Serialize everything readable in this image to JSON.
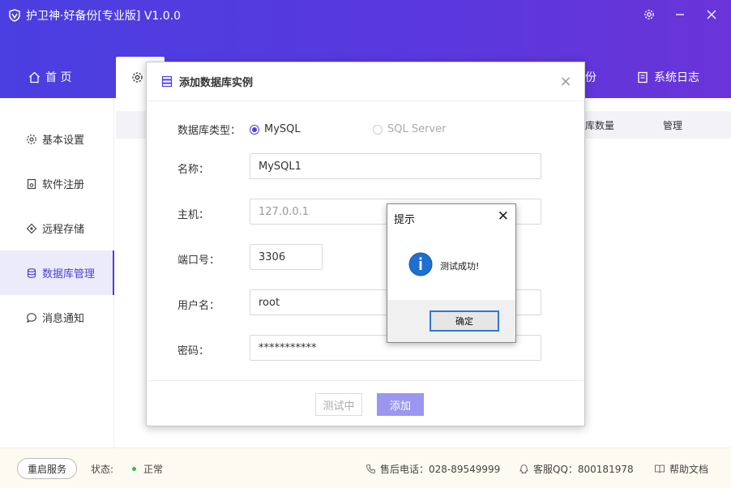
{
  "app": {
    "title": "护卫神·好备份[专业版] V1.0.0"
  },
  "nav": {
    "home": "首 页",
    "backup_partial": "份",
    "system_log": "系统日志"
  },
  "sidebar": {
    "items": [
      {
        "label": "基本设置",
        "icon": "gear-icon"
      },
      {
        "label": "软件注册",
        "icon": "register-icon"
      },
      {
        "label": "远程存储",
        "icon": "remote-storage-icon"
      },
      {
        "label": "数据库管理",
        "icon": "database-icon",
        "active": true
      },
      {
        "label": "消息通知",
        "icon": "message-icon"
      }
    ]
  },
  "table": {
    "headers": [
      "库数量",
      "管理"
    ]
  },
  "footer": {
    "restart": "重启服务",
    "status_label": "状态:",
    "status_value": "正常",
    "phone": "售后电话：028-89549999",
    "qq": "客服QQ：800181978",
    "help": "帮助文档"
  },
  "modal": {
    "title": "添加数据库实例",
    "db_type_label": "数据库类型：",
    "radio_mysql": "MySQL",
    "radio_sqlserver": "SQL Server",
    "name_label": "名称：",
    "name_value": "MySQL1",
    "host_label": "主机：",
    "host_value": "127.0.0.1",
    "port_label": "端口号：",
    "port_value": "3306",
    "user_label": "用户名：",
    "user_value": "root",
    "password_label": "密码：",
    "password_value": "***********",
    "btn_test": "测试中",
    "btn_add": "添加"
  },
  "msgbox": {
    "title": "提示",
    "text": "测试成功!",
    "ok": "确定"
  },
  "colors": {
    "primary": "#4b40e0",
    "header_gradient_end": "#6a34d9",
    "footer_bg": "#fdfaf1"
  }
}
